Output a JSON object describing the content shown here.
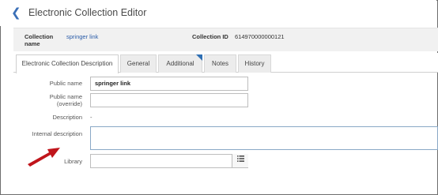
{
  "header": {
    "back_icon": "back-chevron-icon",
    "title": "Electronic Collection Editor"
  },
  "summary": {
    "collection_name_label": "Collection\nname",
    "collection_name_value": "springer link",
    "collection_id_label": "Collection ID",
    "collection_id_value": "614970000000121"
  },
  "tabs": [
    {
      "label": "Electronic Collection Description",
      "active": true
    },
    {
      "label": "General",
      "active": false
    },
    {
      "label": "Additional",
      "active": false
    },
    {
      "label": "Notes",
      "active": false
    },
    {
      "label": "History",
      "active": false
    }
  ],
  "form": {
    "public_name_label": "Public name",
    "public_name_value": "springer link",
    "public_name_override_label": "Public name\n(override)",
    "public_name_override_value": "",
    "description_label": "Description",
    "description_value": "-",
    "internal_description_label": "Internal description",
    "internal_description_value": "",
    "library_label": "Library",
    "library_value": "",
    "library_button_icon": "list-icon"
  },
  "colors": {
    "accent": "#2a5ca8",
    "arrow": "#c0151b",
    "summary_bg": "#f1f1f1"
  }
}
